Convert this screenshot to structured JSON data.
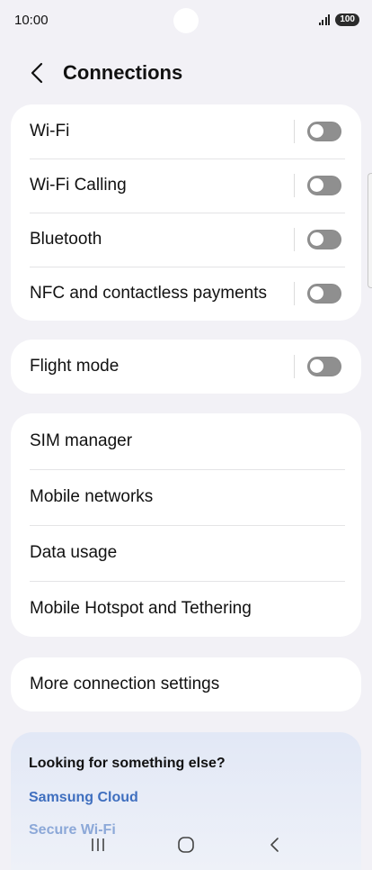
{
  "status_bar": {
    "time": "10:00",
    "battery": "100"
  },
  "header": {
    "title": "Connections"
  },
  "groups": {
    "wireless": [
      {
        "label": "Wi-Fi",
        "on": false
      },
      {
        "label": "Wi-Fi Calling",
        "on": false
      },
      {
        "label": "Bluetooth",
        "on": false
      },
      {
        "label": "NFC and contactless payments",
        "on": false
      }
    ],
    "flight": {
      "label": "Flight mode",
      "on": false
    },
    "network": [
      {
        "label": "SIM manager"
      },
      {
        "label": "Mobile networks"
      },
      {
        "label": "Data usage"
      },
      {
        "label": "Mobile Hotspot and Tethering"
      }
    ],
    "more": {
      "label": "More connection settings"
    }
  },
  "suggestions": {
    "title": "Looking for something else?",
    "links": [
      "Samsung Cloud",
      "Secure Wi-Fi"
    ]
  },
  "colors": {
    "link": "#3f6fbf",
    "toggle_off": "#8f8f8f",
    "background": "#f2f1f6"
  }
}
